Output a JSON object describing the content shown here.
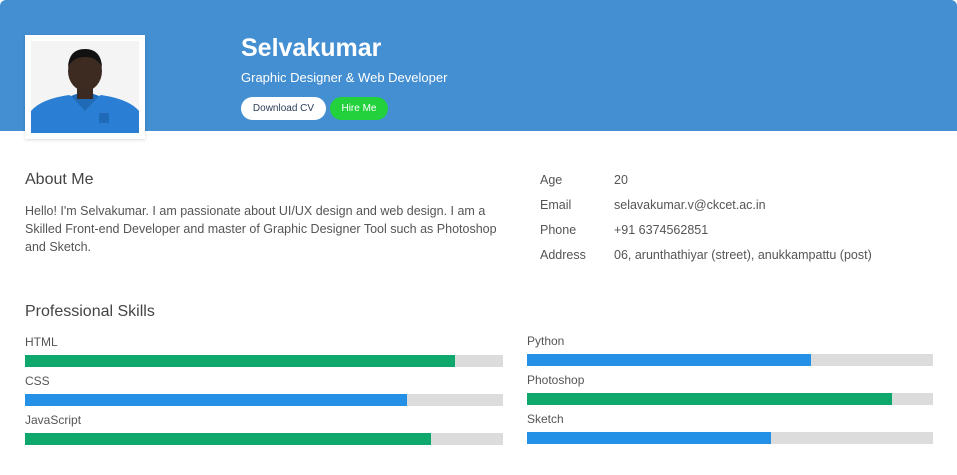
{
  "profile": {
    "name": "Selvakumar",
    "title": "Graphic Designer & Web Developer",
    "download_cv_label": "Download CV",
    "hire_me_label": "Hire Me"
  },
  "about": {
    "heading": "About Me",
    "text": "Hello! I'm Selvakumar. I am passionate about UI/UX design and web design. I am a Skilled Front-end Developer and master of Graphic Designer Tool such as Photoshop and Sketch."
  },
  "info": [
    {
      "label": "Age",
      "value": "20"
    },
    {
      "label": "Email",
      "value": "selavakumar.v@ckcet.ac.in"
    },
    {
      "label": "Phone",
      "value": "+91 6374562851"
    },
    {
      "label": "Address",
      "value": "06, arunthathiyar (street), anukkampattu (post)"
    }
  ],
  "skills": {
    "heading": "Professional Skills",
    "left": [
      {
        "name": "HTML",
        "percent": 90,
        "color": "#0fa86c"
      },
      {
        "name": "CSS",
        "percent": 80,
        "color": "#2491e6"
      },
      {
        "name": "JavaScript",
        "percent": 85,
        "color": "#0fa86c"
      }
    ],
    "right": [
      {
        "name": "Python",
        "percent": 70,
        "color": "#2491e6"
      },
      {
        "name": "Photoshop",
        "percent": 90,
        "color": "#0fa86c"
      },
      {
        "name": "Sketch",
        "percent": 60,
        "color": "#2491e6"
      }
    ]
  },
  "colors": {
    "header": "#438fd2",
    "hire_button": "#22d13b"
  }
}
